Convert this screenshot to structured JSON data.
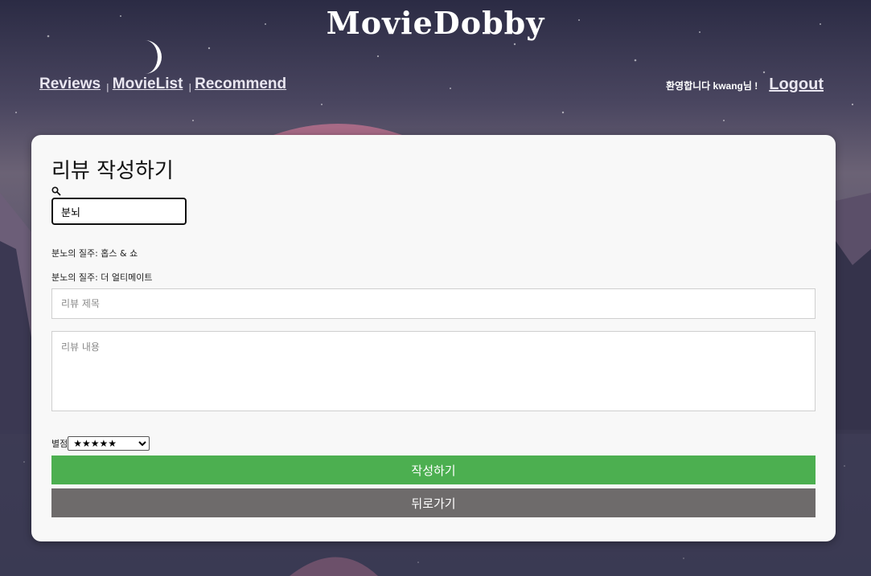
{
  "brand": {
    "logo": "MovieDobby"
  },
  "nav": {
    "items": [
      {
        "label": "Reviews"
      },
      {
        "label": "MovieList"
      },
      {
        "label": "Recommend"
      }
    ],
    "separator": "|"
  },
  "user": {
    "welcome": "환영합니다 kwang님 !",
    "logout": "Logout"
  },
  "form": {
    "heading": "리뷰 작성하기",
    "search": {
      "value": "분뇌",
      "icon": "search-icon"
    },
    "results": [
      "분노의 질주: 홉스 & 쇼",
      "분노의 질주: 더 얼티메이트"
    ],
    "title_placeholder": "리뷰 제목",
    "content_placeholder": "리뷰 내용",
    "rating_label": "별점",
    "rating_selected": "★★★★★",
    "submit_label": "작성하기",
    "back_label": "뒤로가기"
  },
  "colors": {
    "submit": "#4caf50",
    "back": "#6e6b6b",
    "card": "#f8f8f8"
  }
}
